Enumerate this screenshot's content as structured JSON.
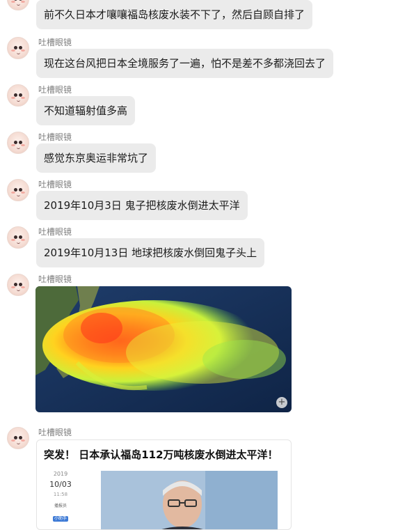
{
  "sender_name": "吐槽眼镜",
  "messages": [
    {
      "text": "前不久日本才嚷嚷福岛核废水装不下了，然后自顾自排了"
    },
    {
      "text": "现在这台风把日本全境服务了一遍，怕不是差不多都浇回去了"
    },
    {
      "text": "不知道辐射值多高"
    },
    {
      "text": "感觉东京奥运非常坑了"
    },
    {
      "text": "2019年10月3日  鬼子把核废水倒进太平洋"
    },
    {
      "text": "2019年10月13日  地球把核废水倒回鬼子头上"
    }
  ],
  "image_message": {
    "expand_icon": "plus-icon",
    "expand_glyph": "+"
  },
  "link_card": {
    "title": "突发！ 日本承认福岛112万吨核废水倒进太平洋！",
    "date_year": "2019",
    "date_md": "10/03",
    "date_time": "11:58",
    "tag_line": "播报员",
    "tag_badge": "小助手"
  },
  "colors": {
    "bubble": "#ebebeb",
    "name": "#7f7f7f",
    "text": "#1b1b1b"
  }
}
